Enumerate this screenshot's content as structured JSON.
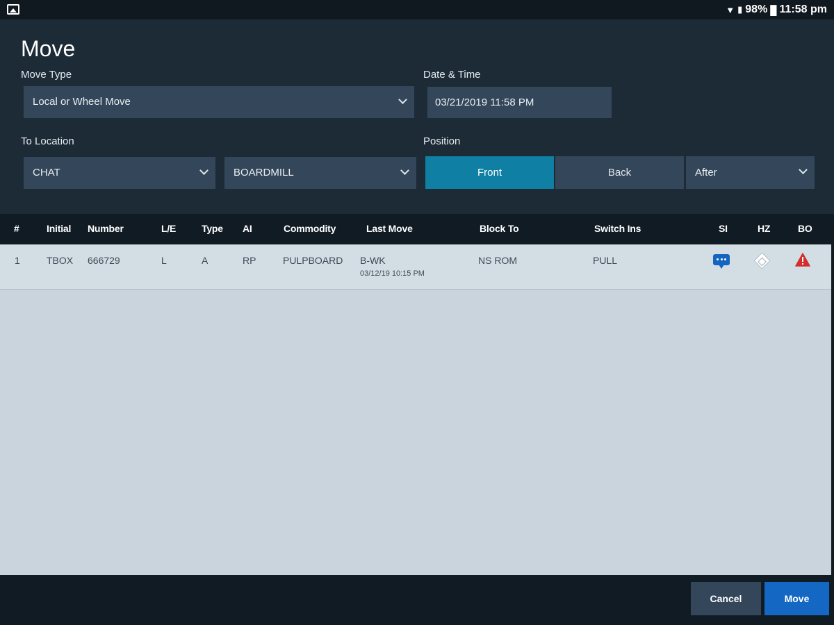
{
  "status_bar": {
    "battery": "98%",
    "time": "11:58 pm"
  },
  "form": {
    "title": "Move",
    "move_type_label": "Move Type",
    "move_type_value": "Local or Wheel Move",
    "datetime_label": "Date & Time",
    "datetime_value": "03/21/2019 11:58 PM",
    "to_location_label": "To Location",
    "location_value": "CHAT",
    "track_value": "BOARDMILL",
    "position_label": "Position",
    "position_options": [
      "Front",
      "Back"
    ],
    "position_selected": "Front",
    "position_after_value": "After"
  },
  "table": {
    "columns": [
      "#",
      "Initial",
      "Number",
      "L/E",
      "Type",
      "AI",
      "Commodity",
      "Last Move",
      "Block To",
      "Switch Ins",
      "SI",
      "HZ",
      "BO"
    ],
    "rows": [
      {
        "num": "1",
        "initial": "TBOX",
        "number": "666729",
        "le": "L",
        "type": "A",
        "ai": "RP",
        "commodity": "PULPBOARD",
        "last_move": "B-WK",
        "last_move_time": "03/12/19 10:15 PM",
        "block_to": "NS ROM",
        "switch_ins": "PULL",
        "si_icon": "comment-icon",
        "hz_icon": "hazmat-diamond-icon",
        "bo_icon": "warning-triangle-icon"
      }
    ]
  },
  "footer": {
    "cancel_label": "Cancel",
    "move_label": "Move"
  },
  "colors": {
    "accent_active": "#0f7fa3",
    "primary_button": "#1468c4",
    "warning": "#d32f2f",
    "info": "#1565c0"
  }
}
